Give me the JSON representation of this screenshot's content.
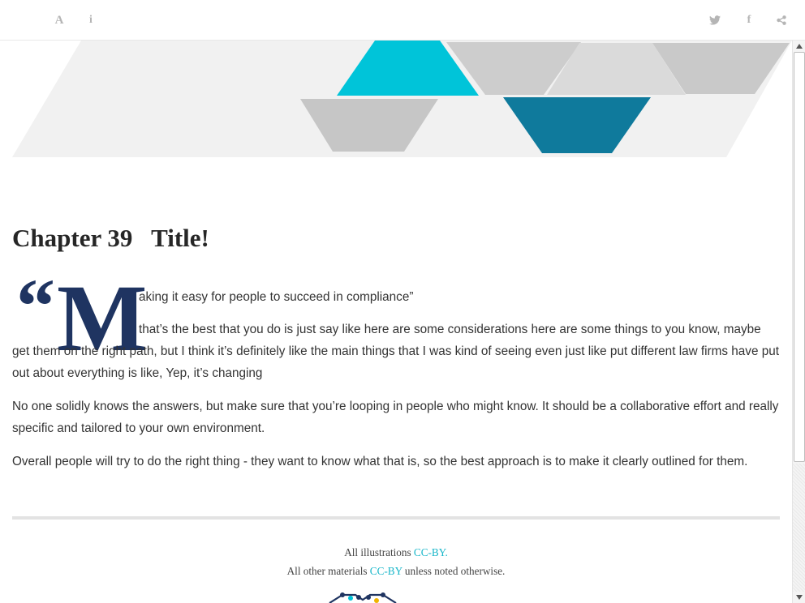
{
  "toolbar": {
    "font_icon": "font-size-icon",
    "info_icon": "info-icon",
    "twitter_icon": "twitter-icon",
    "facebook_icon": "facebook-icon",
    "share_icon": "share-icon",
    "font_glyph": "A",
    "info_glyph": "i",
    "facebook_glyph": "f"
  },
  "banner": {
    "colors": {
      "cyan": "#00c4d9",
      "teal": "#0f7a9c",
      "gray": "#c8c8c8",
      "light": "#f1f1f1"
    }
  },
  "chapter": {
    "title": "Chapter 39   Title!"
  },
  "content": {
    "quote_mark": "“",
    "dropcap": "M",
    "p1_first_line": "aking it easy for people to succeed in compliance”",
    "p1_rest": "that’s the best that you do is just say like here are some considerations here are some things to you know, maybe get them on the right path, but I think it’s definitely like the main things that I was kind of seeing even just like put different law firms have put out about everything is like, Yep, it’s changing",
    "p2": "No one solidly knows the answers, but make sure that you’re looping in people who might know. It should be a collaborative effort and really specific and tailored to your own environment.",
    "p3": "Overall people will try to do the right thing - they want to know what that is, so the best approach is to make it clearly outlined for them."
  },
  "footer": {
    "line1_prefix": "All illustrations ",
    "line1_link": "CC-BY.",
    "line2_prefix": "All other materials ",
    "line2_link": "CC-BY",
    "line2_suffix": " unless noted otherwise.",
    "link_color": "#17b6c9"
  }
}
